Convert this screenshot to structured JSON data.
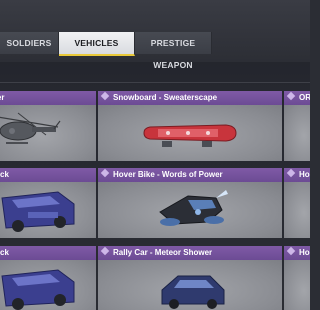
{
  "tabs": [
    {
      "label": "SOLDIERS",
      "active": false
    },
    {
      "label": "VEHICLES",
      "active": true
    },
    {
      "label": "PRESTIGE WEAPON",
      "active": false
    }
  ],
  "colors": {
    "accent": "#e9c93a",
    "card_header": "#7656a0",
    "card_body": "#8e9096"
  },
  "cards": [
    [
      {
        "title": "her",
        "icon": "helicopter-icon"
      },
      {
        "title": "Snowboard - Sweaterscape",
        "icon": "snowboard-icon"
      },
      {
        "title": "OR",
        "icon": ""
      }
    ],
    [
      {
        "title": "ruck",
        "icon": "truck-icon"
      },
      {
        "title": "Hover Bike - Words of Power",
        "icon": "hover-bike-icon"
      },
      {
        "title": "Ho",
        "icon": ""
      }
    ],
    [
      {
        "title": "ruck",
        "icon": "truck-icon"
      },
      {
        "title": "Rally Car - Meteor Shower",
        "icon": "rally-car-icon"
      },
      {
        "title": "Ho",
        "icon": ""
      }
    ]
  ]
}
